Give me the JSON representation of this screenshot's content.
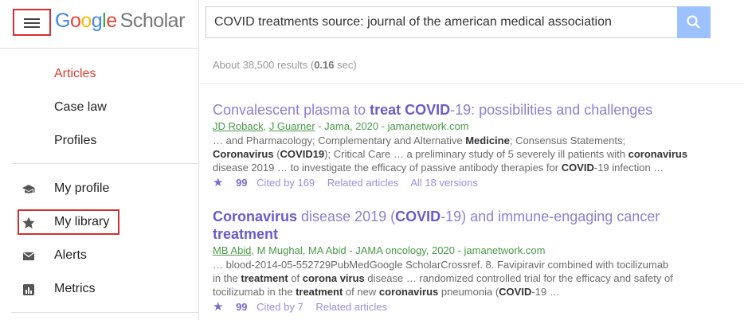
{
  "logo": {
    "part1": "G",
    "part2": "o",
    "part3": "o",
    "part4": "g",
    "part5": "l",
    "part6": "e",
    "scholar": "Scholar"
  },
  "search": {
    "query": "COVID treatments source: journal of the american medical association"
  },
  "stats": {
    "prefix": "About 38,500 results (",
    "time": "0.16",
    "suffix": " sec)"
  },
  "sidebar": {
    "sections": [
      "Articles",
      "Case law",
      "Profiles"
    ],
    "items": [
      {
        "label": "My profile",
        "icon": "graduation-cap-icon"
      },
      {
        "label": "My library",
        "icon": "star-icon"
      },
      {
        "label": "Alerts",
        "icon": "envelope-icon"
      },
      {
        "label": "Metrics",
        "icon": "chart-icon"
      }
    ]
  },
  "results": [
    {
      "title_parts": [
        "Convalescent plasma to ",
        "treat COVID",
        "-19: possibilities and challenges"
      ],
      "authors": [
        "JD Roback",
        "J Guarner"
      ],
      "meta_rest": " - Jama, 2020 - jamanetwork.com",
      "snippet_1": "… and Pharmacology; Complementary and Alternative ",
      "snippet_1b": "Medicine",
      "snippet_1c": "; Consensus Statements;",
      "snippet_2a": "Coronavirus",
      "snippet_2b": " (",
      "snippet_2c": "COVID19",
      "snippet_2d": "); Critical Care … a preliminary study of 5 severely ill patients with ",
      "snippet_2e": "coronavirus",
      "snippet_3a": "disease 2019 … to investigate the efficacy of passive antibody therapies for ",
      "snippet_3b": "COVID",
      "snippet_3c": "-19 infection …",
      "cited": "Cited by 169",
      "related": "Related articles",
      "versions": "All 18 versions"
    },
    {
      "title_parts": [
        "Coronavirus",
        " disease 2019 (",
        "COVID",
        "-19) and immune-engaging cancer",
        "treatment"
      ],
      "authors": [
        "MB Abid"
      ],
      "meta_rest": ", M Mughal, MA Abid - JAMA oncology, 2020 - jamanetwork.com",
      "snippet_1": "… blood-2014-05-552729PubMedGoogle ScholarCrossref. 8. Favipiravir combined with tocilizumab",
      "snippet_2a": "in the ",
      "snippet_2b": "treatment",
      "snippet_2c": " of ",
      "snippet_2d": "corona virus",
      "snippet_2e": " disease … randomized controlled trial for the efficacy and safety of",
      "snippet_3a": "tocilizumab in the ",
      "snippet_3b": "treatment",
      "snippet_3c": " of new ",
      "snippet_3d": "coronavirus",
      "snippet_3e": " pneumonia (",
      "snippet_3f": "COVID",
      "snippet_3g": "-19 …",
      "cited": "Cited by 7",
      "related": "Related articles"
    }
  ],
  "colors": {
    "highlight_box": "#d32f2f",
    "active_nav": "#d23f31",
    "title_link": "#8e7fcf",
    "meta_green": "#4a9a4a"
  }
}
